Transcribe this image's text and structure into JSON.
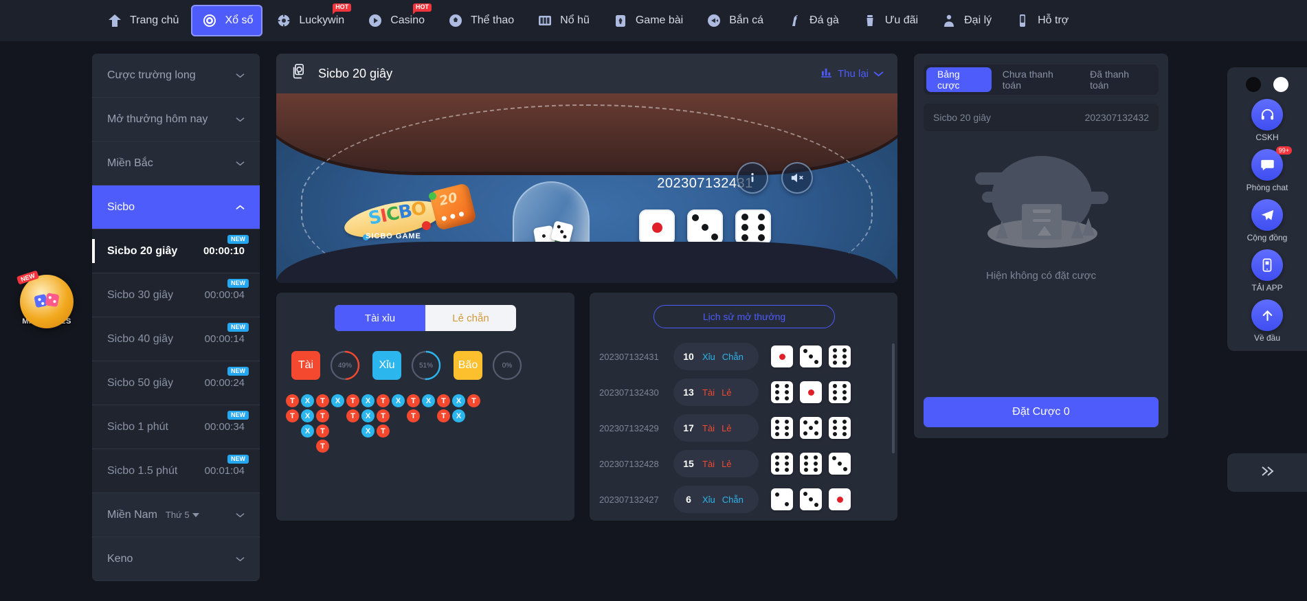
{
  "topnav": {
    "items": [
      {
        "label": "Trang chủ",
        "icon": "home-icon",
        "hot": false,
        "active": false
      },
      {
        "label": "Xổ số",
        "icon": "lottery-icon",
        "hot": false,
        "active": true
      },
      {
        "label": "Luckywin",
        "icon": "luckywin-icon",
        "hot": true,
        "hot_label": "HOT",
        "active": false
      },
      {
        "label": "Casino",
        "icon": "casino-icon",
        "hot": true,
        "hot_label": "HOT",
        "active": false
      },
      {
        "label": "Thể thao",
        "icon": "sports-icon",
        "hot": false,
        "active": false
      },
      {
        "label": "Nổ hũ",
        "icon": "slots-icon",
        "hot": false,
        "active": false
      },
      {
        "label": "Game bài",
        "icon": "cards-icon",
        "hot": false,
        "active": false
      },
      {
        "label": "Bắn cá",
        "icon": "fishing-icon",
        "hot": false,
        "active": false
      },
      {
        "label": "Đá gà",
        "icon": "cockfight-icon",
        "hot": false,
        "active": false
      },
      {
        "label": "Ưu đãi",
        "icon": "promo-icon",
        "hot": false,
        "active": false
      },
      {
        "label": "Đại lý",
        "icon": "agent-icon",
        "hot": false,
        "active": false
      },
      {
        "label": "Hỗ trợ",
        "icon": "support-icon",
        "hot": false,
        "active": false
      }
    ]
  },
  "sidebar": {
    "groups": [
      {
        "label": "Cược trường long",
        "type": "head",
        "expanded": false
      },
      {
        "label": "Mở thưởng hôm nay",
        "type": "head",
        "expanded": false
      },
      {
        "label": "Miền Bắc",
        "type": "head",
        "expanded": false
      },
      {
        "label": "Sicbo",
        "type": "selected",
        "expanded": true
      }
    ],
    "sicbo_items": [
      {
        "label": "Sicbo 20 giây",
        "timer": "00:00:10",
        "badge": "NEW",
        "active": true
      },
      {
        "label": "Sicbo 30 giây",
        "timer": "00:00:04",
        "badge": "NEW",
        "active": false
      },
      {
        "label": "Sicbo 40 giây",
        "timer": "00:00:14",
        "badge": "NEW",
        "active": false
      },
      {
        "label": "Sicbo 50 giây",
        "timer": "00:00:24",
        "badge": "NEW",
        "active": false
      },
      {
        "label": "Sicbo 1 phút",
        "timer": "00:00:34",
        "badge": "NEW",
        "active": false
      },
      {
        "label": "Sicbo 1.5 phút",
        "timer": "00:01:04",
        "badge": "NEW",
        "active": false
      }
    ],
    "footer_groups": [
      {
        "label": "Miền Nam",
        "extra": "Thứ 5"
      },
      {
        "label": "Keno",
        "extra": ""
      }
    ]
  },
  "minigames": {
    "badge": "NEW",
    "label": "MINI GAMES"
  },
  "game": {
    "title": "Sicbo 20 giây",
    "title_icon": "cards-dice-icon",
    "collect_label": "Thu lại",
    "collect_icon": "chart-icon",
    "current_issue": "202307132432",
    "countdown_digits": [
      "0",
      "0",
      "0",
      "0",
      "1",
      "0"
    ],
    "logo_text": [
      "S",
      "I",
      "C",
      "B",
      "O"
    ],
    "logo_sub": "SICBO GAME",
    "logo_die_number": "20",
    "last_issue": "202307132431",
    "last_dice": [
      1,
      3,
      6
    ],
    "info_icon": "info-icon",
    "sound_icon": "sound-off-icon"
  },
  "bet_panel": {
    "tabs": [
      {
        "label": "Tài xỉu",
        "on": true
      },
      {
        "label": "Lẻ chẵn",
        "on": false
      }
    ],
    "options": [
      {
        "label": "Tài",
        "pct": "49%",
        "color": "#f4492f",
        "ring": 49
      },
      {
        "label": "Xỉu",
        "pct": "51%",
        "color": "#2cb6ee",
        "ring": 51
      },
      {
        "label": "Bão",
        "pct": "0%",
        "color": "#fcc02e",
        "ring": 0
      }
    ],
    "road_columns": [
      [
        "T",
        "T"
      ],
      [
        "X",
        "X",
        "X"
      ],
      [
        "T",
        "T",
        "T",
        "T"
      ],
      [
        "X"
      ],
      [
        "T",
        "T"
      ],
      [
        "X",
        "X",
        "X"
      ],
      [
        "T",
        "T",
        "T"
      ],
      [
        "X"
      ],
      [
        "T",
        "T"
      ],
      [
        "X"
      ],
      [
        "T",
        "T"
      ],
      [
        "X",
        "X"
      ],
      [
        "T"
      ]
    ]
  },
  "history": {
    "button_label": "Lịch sử mở thưởng",
    "rows": [
      {
        "issue": "202307132431",
        "sum": "10",
        "bigsmall": "Xỉu",
        "bigsmall_type": "xiu",
        "oddeven": "Chẵn",
        "dice": [
          1,
          3,
          6
        ]
      },
      {
        "issue": "202307132430",
        "sum": "13",
        "bigsmall": "Tài",
        "bigsmall_type": "tai",
        "oddeven": "Lẻ",
        "dice": [
          6,
          1,
          6
        ]
      },
      {
        "issue": "202307132429",
        "sum": "17",
        "bigsmall": "Tài",
        "bigsmall_type": "tai",
        "oddeven": "Lẻ",
        "dice": [
          6,
          5,
          6
        ]
      },
      {
        "issue": "202307132428",
        "sum": "15",
        "bigsmall": "Tài",
        "bigsmall_type": "tai",
        "oddeven": "Lẻ",
        "dice": [
          6,
          6,
          3
        ]
      },
      {
        "issue": "202307132427",
        "sum": "6",
        "bigsmall": "Xỉu",
        "bigsmall_type": "xiu",
        "oddeven": "Chẵn",
        "dice": [
          2,
          3,
          1
        ]
      }
    ]
  },
  "bet_board": {
    "tabs": [
      {
        "label": "Bảng cược",
        "on": true
      },
      {
        "label": "Chưa thanh toán",
        "on": false
      },
      {
        "label": "Đã thanh toán",
        "on": false
      }
    ],
    "row_name": "Sicbo 20 giây",
    "row_issue": "202307132432",
    "empty_text": "Hiện không có đặt cược",
    "cta_label": "Đặt Cược 0"
  },
  "floatbar": {
    "items": [
      {
        "label": "CSKH",
        "icon": "headset-icon",
        "badge": ""
      },
      {
        "label": "Phòng chat",
        "icon": "chat-icon",
        "badge": "99+"
      },
      {
        "label": "Cộng đồng",
        "icon": "telegram-icon",
        "badge": ""
      },
      {
        "label": "TẢI APP",
        "icon": "mobile-icon",
        "badge": ""
      },
      {
        "label": "Về đầu",
        "icon": "arrow-up-icon",
        "badge": ""
      }
    ],
    "collapse_icon": "chevrons-right-icon"
  },
  "colors": {
    "accent": "#4d5cfb",
    "tai": "#f4492f",
    "xiu": "#2cb6ee",
    "bao": "#fcc02e",
    "bg": "#14161f",
    "panel": "#262b38"
  }
}
